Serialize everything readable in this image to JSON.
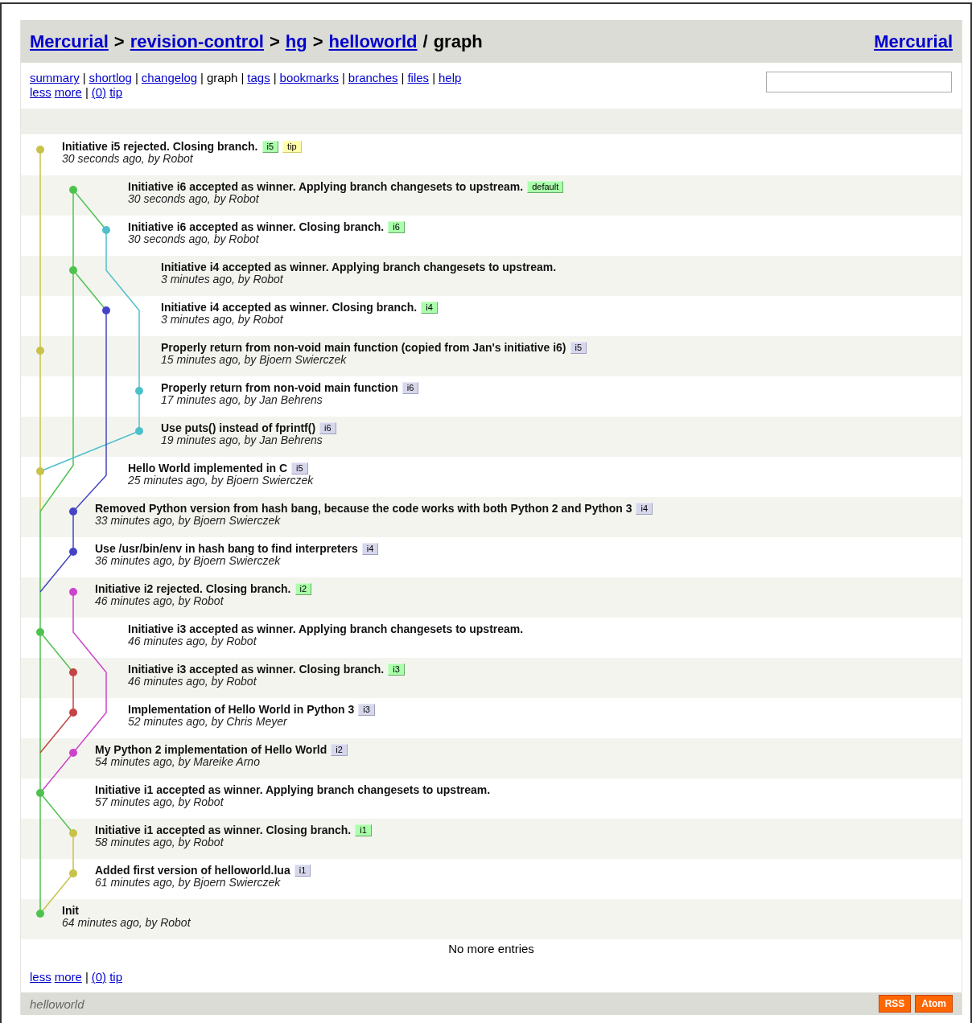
{
  "breadcrumb": {
    "links": [
      {
        "label": "Mercurial"
      },
      {
        "sep": ">",
        "label": "revision-control"
      },
      {
        "sep": ">",
        "label": "hg"
      },
      {
        "sep": ">",
        "label": "helloworld"
      }
    ],
    "current": {
      "sep": "/",
      "label": "graph"
    }
  },
  "logo_link": "Mercurial",
  "nav": [
    {
      "label": "summary",
      "selected": false
    },
    {
      "label": "shortlog",
      "selected": false
    },
    {
      "label": "changelog",
      "selected": false
    },
    {
      "label": "graph",
      "selected": true
    },
    {
      "label": "tags",
      "selected": false
    },
    {
      "label": "bookmarks",
      "selected": false
    },
    {
      "label": "branches",
      "selected": false
    },
    {
      "label": "files",
      "selected": false
    },
    {
      "label": "help",
      "selected": false
    }
  ],
  "nav_separator": "|",
  "pager_top": {
    "links": [
      "less",
      "more"
    ],
    "separator": "|",
    "revs": [
      "(0)",
      "tip"
    ]
  },
  "changesets": [
    {
      "description": "Initiative i5 rejected. Closing branch.",
      "meta": "30 seconds ago, by Robot",
      "color": "#c8c24a",
      "tags": [
        {
          "label": "i5",
          "kind": "head"
        },
        {
          "label": "tip",
          "kind": "tag"
        }
      ]
    },
    {
      "description": "Initiative i6 accepted as winner. Applying branch changesets to upstream.",
      "meta": "30 seconds ago, by Robot",
      "color": "#4ec24e",
      "tags": [
        {
          "label": "default",
          "kind": "head"
        }
      ]
    },
    {
      "description": "Initiative i6 accepted as winner. Closing branch.",
      "meta": "30 seconds ago, by Robot",
      "color": "#4ec0cc",
      "tags": [
        {
          "label": "i6",
          "kind": "head"
        }
      ]
    },
    {
      "description": "Initiative i4 accepted as winner. Applying branch changesets to upstream.",
      "meta": "3 minutes ago, by Robot",
      "color": "#4ec24e"
    },
    {
      "description": "Initiative i4 accepted as winner. Closing branch.",
      "meta": "3 minutes ago, by Robot",
      "color": "#4444c4",
      "tags": [
        {
          "label": "i4",
          "kind": "head"
        }
      ]
    },
    {
      "description": "Properly return from non-void main function (copied from Jan's initiative i6)",
      "meta": "15 minutes ago, by Bjoern Swierczek",
      "color": "#c8c24a",
      "tags": [
        {
          "label": "i5",
          "kind": "branch"
        }
      ]
    },
    {
      "description": "Properly return from non-void main function",
      "meta": "17 minutes ago, by Jan Behrens",
      "color": "#4ec0cc",
      "tags": [
        {
          "label": "i6",
          "kind": "branch"
        }
      ]
    },
    {
      "description": "Use puts() instead of fprintf()",
      "meta": "19 minutes ago, by Jan Behrens",
      "color": "#4ec0cc",
      "tags": [
        {
          "label": "i6",
          "kind": "branch"
        }
      ]
    },
    {
      "description": "Hello World implemented in C",
      "meta": "25 minutes ago, by Bjoern Swierczek",
      "color": "#c8c24a",
      "tags": [
        {
          "label": "i5",
          "kind": "branch"
        }
      ]
    },
    {
      "description": "Removed Python version from hash bang, because the code works with both Python 2 and Python 3",
      "meta": "33 minutes ago, by Bjoern Swierczek",
      "color": "#4444c4",
      "tags": [
        {
          "label": "i4",
          "kind": "branch"
        }
      ]
    },
    {
      "description": "Use /usr/bin/env in hash bang to find interpreters",
      "meta": "36 minutes ago, by Bjoern Swierczek",
      "color": "#4444c4",
      "tags": [
        {
          "label": "i4",
          "kind": "branch"
        }
      ]
    },
    {
      "description": "Initiative i2 rejected. Closing branch.",
      "meta": "46 minutes ago, by Robot",
      "color": "#cc44cc",
      "tags": [
        {
          "label": "i2",
          "kind": "head"
        }
      ]
    },
    {
      "description": "Initiative i3 accepted as winner. Applying branch changesets to upstream.",
      "meta": "46 minutes ago, by Robot",
      "color": "#4ec24e"
    },
    {
      "description": "Initiative i3 accepted as winner. Closing branch.",
      "meta": "46 minutes ago, by Robot",
      "color": "#c44444",
      "tags": [
        {
          "label": "i3",
          "kind": "head"
        }
      ]
    },
    {
      "description": "Implementation of Hello World in Python 3",
      "meta": "52 minutes ago, by Chris Meyer",
      "color": "#c44444",
      "tags": [
        {
          "label": "i3",
          "kind": "branch"
        }
      ]
    },
    {
      "description": "My Python 2 implementation of Hello World",
      "meta": "54 minutes ago, by Mareike Arno",
      "color": "#cc44cc",
      "tags": [
        {
          "label": "i2",
          "kind": "branch"
        }
      ]
    },
    {
      "description": "Initiative i1 accepted as winner. Applying branch changesets to upstream.",
      "meta": "57 minutes ago, by Robot",
      "color": "#4ec24e"
    },
    {
      "description": "Initiative i1 accepted as winner. Closing branch.",
      "meta": "58 minutes ago, by Robot",
      "color": "#c8c24a",
      "tags": [
        {
          "label": "i1",
          "kind": "head"
        }
      ]
    },
    {
      "description": "Added first version of helloworld.lua",
      "meta": "61 minutes ago, by Bjoern Swierczek",
      "color": "#c8c24a",
      "tags": [
        {
          "label": "i1",
          "kind": "branch"
        }
      ]
    },
    {
      "description": "Init",
      "meta": "64 minutes ago, by Robot",
      "color": "#4ec24e"
    }
  ],
  "no_more": "No more entries",
  "pager_bottom": {
    "links": [
      "less",
      "more"
    ],
    "separator": "|",
    "revs": [
      "(0)",
      "tip"
    ]
  },
  "footer": {
    "repo": "helloworld",
    "feeds": [
      "RSS",
      "Atom"
    ]
  }
}
